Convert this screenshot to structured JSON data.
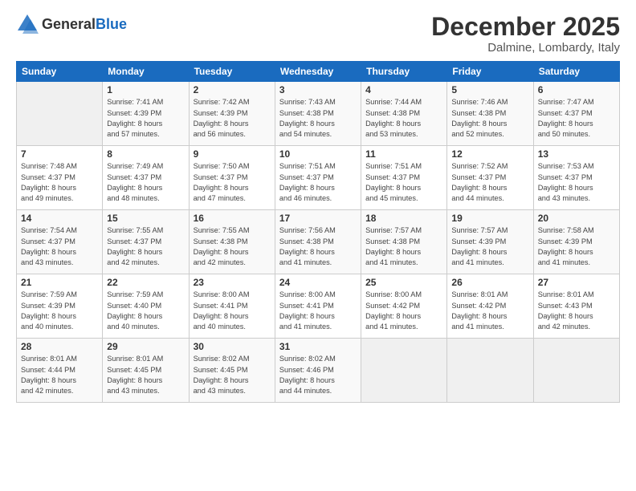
{
  "logo": {
    "general": "General",
    "blue": "Blue"
  },
  "title": "December 2025",
  "location": "Dalmine, Lombardy, Italy",
  "days_header": [
    "Sunday",
    "Monday",
    "Tuesday",
    "Wednesday",
    "Thursday",
    "Friday",
    "Saturday"
  ],
  "weeks": [
    [
      {
        "num": "",
        "info": ""
      },
      {
        "num": "1",
        "info": "Sunrise: 7:41 AM\nSunset: 4:39 PM\nDaylight: 8 hours\nand 57 minutes."
      },
      {
        "num": "2",
        "info": "Sunrise: 7:42 AM\nSunset: 4:39 PM\nDaylight: 8 hours\nand 56 minutes."
      },
      {
        "num": "3",
        "info": "Sunrise: 7:43 AM\nSunset: 4:38 PM\nDaylight: 8 hours\nand 54 minutes."
      },
      {
        "num": "4",
        "info": "Sunrise: 7:44 AM\nSunset: 4:38 PM\nDaylight: 8 hours\nand 53 minutes."
      },
      {
        "num": "5",
        "info": "Sunrise: 7:46 AM\nSunset: 4:38 PM\nDaylight: 8 hours\nand 52 minutes."
      },
      {
        "num": "6",
        "info": "Sunrise: 7:47 AM\nSunset: 4:37 PM\nDaylight: 8 hours\nand 50 minutes."
      }
    ],
    [
      {
        "num": "7",
        "info": "Sunrise: 7:48 AM\nSunset: 4:37 PM\nDaylight: 8 hours\nand 49 minutes."
      },
      {
        "num": "8",
        "info": "Sunrise: 7:49 AM\nSunset: 4:37 PM\nDaylight: 8 hours\nand 48 minutes."
      },
      {
        "num": "9",
        "info": "Sunrise: 7:50 AM\nSunset: 4:37 PM\nDaylight: 8 hours\nand 47 minutes."
      },
      {
        "num": "10",
        "info": "Sunrise: 7:51 AM\nSunset: 4:37 PM\nDaylight: 8 hours\nand 46 minutes."
      },
      {
        "num": "11",
        "info": "Sunrise: 7:51 AM\nSunset: 4:37 PM\nDaylight: 8 hours\nand 45 minutes."
      },
      {
        "num": "12",
        "info": "Sunrise: 7:52 AM\nSunset: 4:37 PM\nDaylight: 8 hours\nand 44 minutes."
      },
      {
        "num": "13",
        "info": "Sunrise: 7:53 AM\nSunset: 4:37 PM\nDaylight: 8 hours\nand 43 minutes."
      }
    ],
    [
      {
        "num": "14",
        "info": "Sunrise: 7:54 AM\nSunset: 4:37 PM\nDaylight: 8 hours\nand 43 minutes."
      },
      {
        "num": "15",
        "info": "Sunrise: 7:55 AM\nSunset: 4:37 PM\nDaylight: 8 hours\nand 42 minutes."
      },
      {
        "num": "16",
        "info": "Sunrise: 7:55 AM\nSunset: 4:38 PM\nDaylight: 8 hours\nand 42 minutes."
      },
      {
        "num": "17",
        "info": "Sunrise: 7:56 AM\nSunset: 4:38 PM\nDaylight: 8 hours\nand 41 minutes."
      },
      {
        "num": "18",
        "info": "Sunrise: 7:57 AM\nSunset: 4:38 PM\nDaylight: 8 hours\nand 41 minutes."
      },
      {
        "num": "19",
        "info": "Sunrise: 7:57 AM\nSunset: 4:39 PM\nDaylight: 8 hours\nand 41 minutes."
      },
      {
        "num": "20",
        "info": "Sunrise: 7:58 AM\nSunset: 4:39 PM\nDaylight: 8 hours\nand 41 minutes."
      }
    ],
    [
      {
        "num": "21",
        "info": "Sunrise: 7:59 AM\nSunset: 4:39 PM\nDaylight: 8 hours\nand 40 minutes."
      },
      {
        "num": "22",
        "info": "Sunrise: 7:59 AM\nSunset: 4:40 PM\nDaylight: 8 hours\nand 40 minutes."
      },
      {
        "num": "23",
        "info": "Sunrise: 8:00 AM\nSunset: 4:41 PM\nDaylight: 8 hours\nand 40 minutes."
      },
      {
        "num": "24",
        "info": "Sunrise: 8:00 AM\nSunset: 4:41 PM\nDaylight: 8 hours\nand 41 minutes."
      },
      {
        "num": "25",
        "info": "Sunrise: 8:00 AM\nSunset: 4:42 PM\nDaylight: 8 hours\nand 41 minutes."
      },
      {
        "num": "26",
        "info": "Sunrise: 8:01 AM\nSunset: 4:42 PM\nDaylight: 8 hours\nand 41 minutes."
      },
      {
        "num": "27",
        "info": "Sunrise: 8:01 AM\nSunset: 4:43 PM\nDaylight: 8 hours\nand 42 minutes."
      }
    ],
    [
      {
        "num": "28",
        "info": "Sunrise: 8:01 AM\nSunset: 4:44 PM\nDaylight: 8 hours\nand 42 minutes."
      },
      {
        "num": "29",
        "info": "Sunrise: 8:01 AM\nSunset: 4:45 PM\nDaylight: 8 hours\nand 43 minutes."
      },
      {
        "num": "30",
        "info": "Sunrise: 8:02 AM\nSunset: 4:45 PM\nDaylight: 8 hours\nand 43 minutes."
      },
      {
        "num": "31",
        "info": "Sunrise: 8:02 AM\nSunset: 4:46 PM\nDaylight: 8 hours\nand 44 minutes."
      },
      {
        "num": "",
        "info": ""
      },
      {
        "num": "",
        "info": ""
      },
      {
        "num": "",
        "info": ""
      }
    ]
  ]
}
